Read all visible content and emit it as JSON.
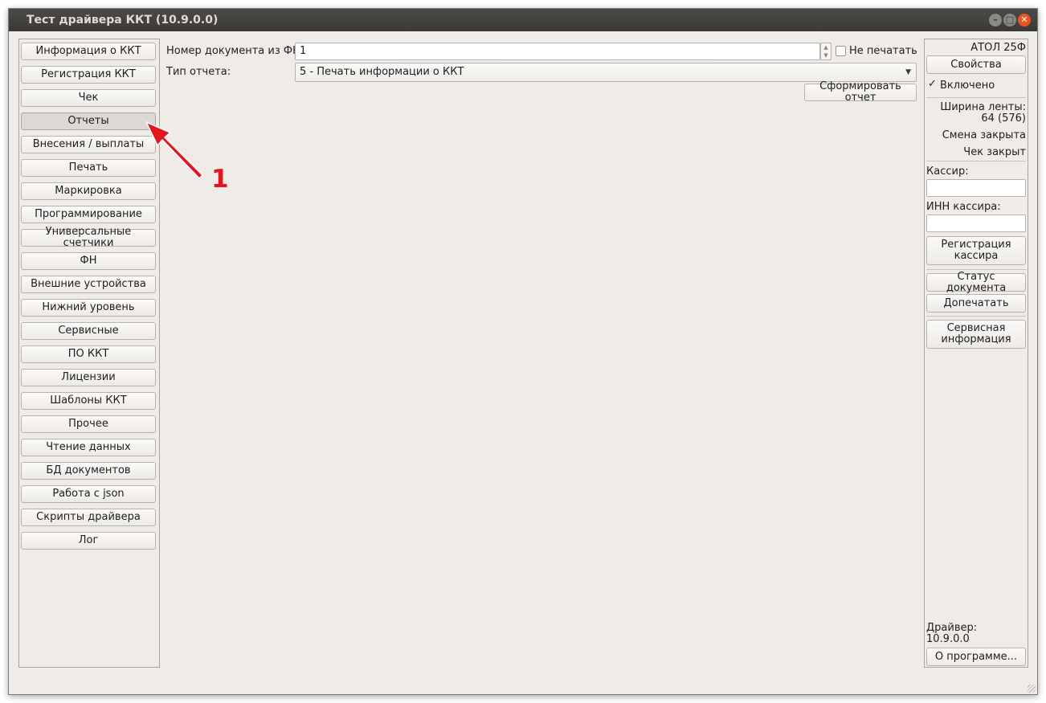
{
  "window": {
    "title": "Тест драйвера ККТ (10.9.0.0)"
  },
  "nav": {
    "items": [
      "Информация о ККТ",
      "Регистрация ККТ",
      "Чек",
      "Отчеты",
      "Внесения / выплаты",
      "Печать",
      "Маркировка",
      "Программирование",
      "Универсальные счетчики",
      "ФН",
      "Внешние устройства",
      "Нижний уровень",
      "Сервисные",
      "ПО ККТ",
      "Лицензии",
      "Шаблоны ККТ",
      "Прочее",
      "Чтение данных",
      "БД документов",
      "Работа с json",
      "Скрипты драйвера",
      "Лог"
    ],
    "active": "Отчеты"
  },
  "main": {
    "doc_number_label": "Номер документа из ФН:",
    "doc_number_value": "1",
    "no_print_label": "Не печатать",
    "no_print_checked": false,
    "report_type_label": "Тип отчета:",
    "report_type_value": "5 - Печать информации о ККТ",
    "generate_button": "Сформировать отчет"
  },
  "annotation": {
    "number": "1",
    "color": "#e8141b"
  },
  "side": {
    "device": "АТОЛ 25Ф",
    "properties_button": "Свойства",
    "enabled_label": "Включено",
    "enabled_checked": true,
    "tape_width_label": "Ширина ленты:",
    "tape_width_value": "64 (576)",
    "shift_status": "Смена закрыта",
    "receipt_status": "Чек закрыт",
    "cashier_label": "Кассир:",
    "cashier_value": "",
    "cashier_inn_label": "ИНН кассира:",
    "cashier_inn_value": "",
    "register_cashier_line1": "Регистрация",
    "register_cashier_line2": "кассира",
    "doc_status_button": "Статус документа",
    "reprint_button": "Допечатать",
    "service_info_line1": "Сервисная",
    "service_info_line2": "информация",
    "driver_label": "Драйвер:",
    "driver_version": "10.9.0.0",
    "about_button": "О программе..."
  }
}
